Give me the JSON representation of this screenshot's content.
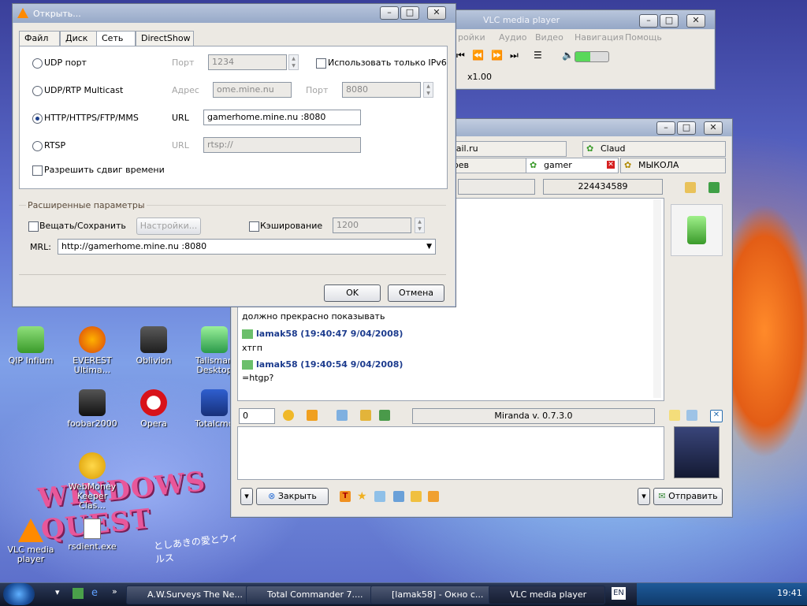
{
  "desktop_icons": [
    {
      "label": "QIP Infium"
    },
    {
      "label": "EVEREST Ultima..."
    },
    {
      "label": "Oblivion"
    },
    {
      "label": "Talisman Desktop"
    },
    {
      "label": "foobar2000"
    },
    {
      "label": "Opera"
    },
    {
      "label": "Totalcmd"
    },
    {
      "label": "WebMoney Keeper Clas..."
    },
    {
      "label": "VLC media player"
    },
    {
      "label": "rsdient.exe"
    }
  ],
  "vlc_main": {
    "title": "VLC media player",
    "menu": [
      "ройки",
      "Аудио",
      "Видео",
      "Навигация",
      "Помощь"
    ],
    "speed": "x1.00"
  },
  "open_dialog": {
    "title": "Открыть...",
    "tabs": [
      "Файл",
      "Диск",
      "Сеть",
      "DirectShow"
    ],
    "active_tab": "Сеть",
    "udp": {
      "label": "UDP порт",
      "port_label": "Порт",
      "port_value": "1234",
      "ipv6_label": "Использовать только IPv6"
    },
    "multicast": {
      "label": "UDP/RTP Multicast",
      "addr_label": "Адрес",
      "addr_value": "ome.mine.nu",
      "port_label": "Порт",
      "port_value": "8080"
    },
    "http": {
      "label": "HTTP/HTTPS/FTP/MMS",
      "url_label": "URL",
      "url_value": "gamerhome.mine.nu :8080"
    },
    "rtsp": {
      "label": "RTSP",
      "url_label": "URL",
      "url_value": "rtsp://"
    },
    "timeshift_label": "Разрешить сдвиг времени",
    "advanced": {
      "title": "Расширенные параметры",
      "stream_label": "Вещать/Сохранить",
      "settings_button": "Настройки...",
      "cache_label": "Кэширование",
      "cache_value": "1200",
      "mrl_label": "MRL:",
      "mrl_value": "http://gamerhome.mine.nu :8080"
    },
    "ok_button": "OK",
    "cancel_button": "Отмена"
  },
  "chat": {
    "tabs_row1": [
      "mail.ru",
      "Claud"
    ],
    "tabs_row2": [
      "ерев",
      "gamer",
      "МЫКОЛА"
    ],
    "uin": "224434589",
    "messages": [
      {
        "text": "должно прекрасно показывать"
      },
      {
        "nick": "lamak58",
        "time": "(19:40:47 9/04/2008)",
        "text": "хтгп"
      },
      {
        "nick": "lamak58",
        "time": "(19:40:54 9/04/2008)",
        "text": "=htgp?"
      }
    ],
    "char_count": "0",
    "status_text": "Miranda v. 0.7.3.0",
    "close_button": "Закрыть",
    "send_button": "Отправить"
  },
  "desktop_art": {
    "logo_text": "WINDOWS QUEST",
    "subtitle": "としあきの愛とウィルス"
  },
  "taskbar": {
    "items": [
      "A.W.Surveys The Ne...",
      "Total Commander 7....",
      "[lamak58] - Окно с...",
      "VLC media player"
    ],
    "lang": "EN",
    "clock": "19:41"
  }
}
